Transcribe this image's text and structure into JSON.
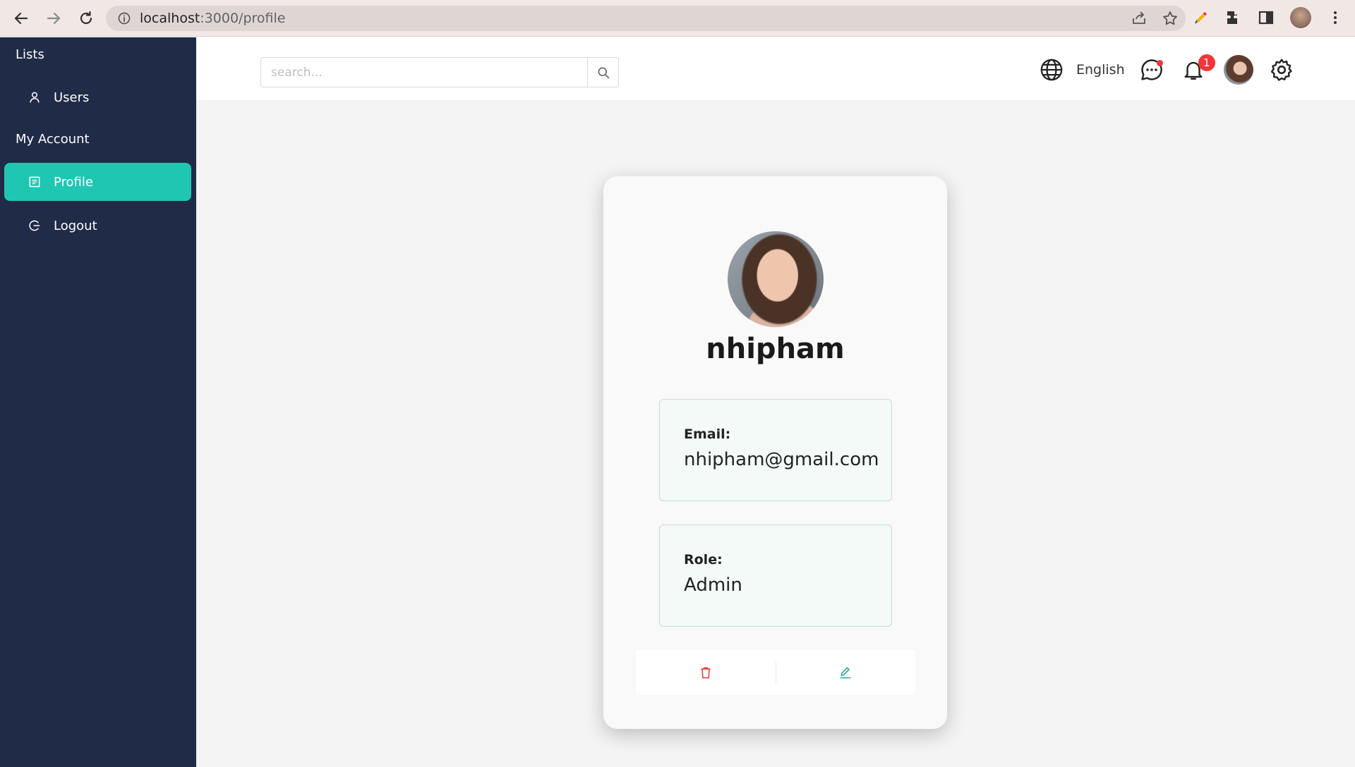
{
  "browser": {
    "url_host": "localhost",
    "url_path": ":3000/profile",
    "icons": [
      "back-arrow-icon",
      "forward-arrow-icon",
      "reload-icon",
      "info-icon",
      "share-icon",
      "star-icon",
      "pen-extension-icon",
      "puzzle-icon",
      "side-panel-icon",
      "chrome-profile-avatar",
      "kebab-menu-icon"
    ]
  },
  "sidebar": {
    "section_lists": "Lists",
    "users_label": "Users",
    "section_account": "My Account",
    "profile_label": "Profile",
    "logout_label": "Logout",
    "active_color": "#1fc7b2",
    "background_color": "#1f2b47"
  },
  "topbar": {
    "search_placeholder": "search...",
    "language_label": "English",
    "notification_count": "1",
    "icons": [
      "globe-icon",
      "chat-icon",
      "bell-icon",
      "user-avatar",
      "gear-icon"
    ]
  },
  "profile": {
    "username": "nhipham",
    "email_label": "Email:",
    "email_value": "nhipham@gmail.com",
    "role_label": "Role:",
    "role_value": "Admin",
    "delete_color": "#e53935",
    "edit_color": "#1fa98e"
  }
}
